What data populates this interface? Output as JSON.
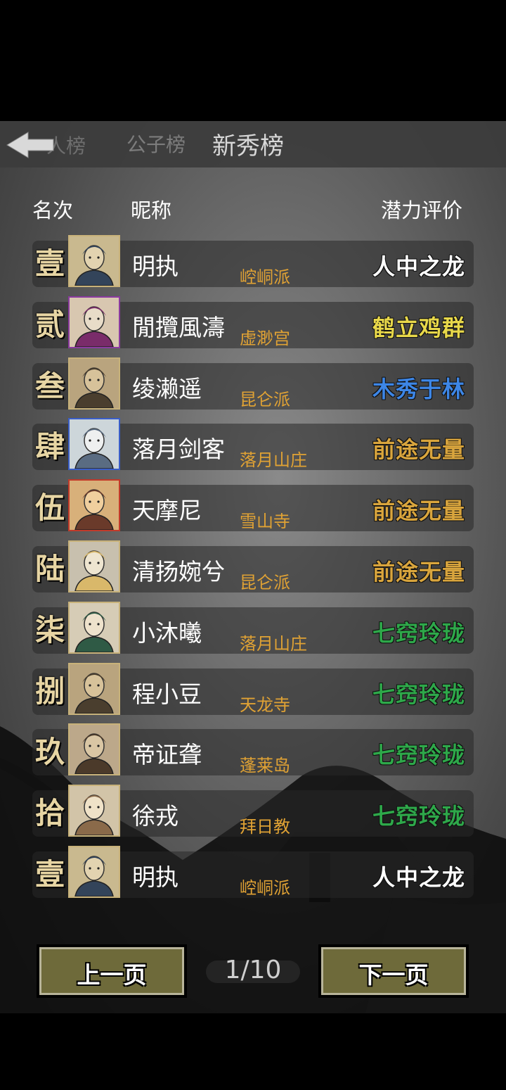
{
  "tabs": [
    {
      "label": "人榜"
    },
    {
      "label": "公子榜"
    },
    {
      "label": "新秀榜"
    }
  ],
  "headers": {
    "rank": "名次",
    "nickname": "昵称",
    "potential": "潜力评价"
  },
  "rating_colors": {
    "gold": "#ffffff",
    "yellow": "#e8d84a",
    "blue": "#4a90e8",
    "orange": "#d8a63c",
    "green": "#2ea84a",
    "white": "#ffffff"
  },
  "rows": [
    {
      "rank": "壹",
      "nick": "明执",
      "sect": "崆峒派",
      "rating": "人中之龙",
      "rating_color": "#ffffff",
      "avatar": "swordsman-portrait",
      "frame": "gold"
    },
    {
      "rank": "贰",
      "nick": "閒攬風濤",
      "sect": "虚渺宫",
      "rating": "鹤立鸡群",
      "rating_color": "#e8d84a",
      "avatar": "dragon-mask-portrait",
      "frame": "purple"
    },
    {
      "rank": "叁",
      "nick": "绫濑遥",
      "sect": "昆仑派",
      "rating": "木秀于林",
      "rating_color": "#3d86e6",
      "avatar": "bearded-elder-portrait",
      "frame": "gold"
    },
    {
      "rank": "肆",
      "nick": "落月剑客",
      "sect": "落月山庄",
      "rating": "前途无量",
      "rating_color": "#d9a53d",
      "avatar": "white-robed-swordsman-portrait",
      "frame": "blue"
    },
    {
      "rank": "伍",
      "nick": "天摩尼",
      "sect": "雪山寺",
      "rating": "前途无量",
      "rating_color": "#d9a53d",
      "avatar": "scholar-portrait",
      "frame": "red"
    },
    {
      "rank": "陆",
      "nick": "清扬婉兮",
      "sect": "昆仑派",
      "rating": "前途无量",
      "rating_color": "#d9a53d",
      "avatar": "blonde-woman-portrait",
      "frame": "gold"
    },
    {
      "rank": "柒",
      "nick": "小沐曦",
      "sect": "落月山庄",
      "rating": "七窍玲珑",
      "rating_color": "#2ea84a",
      "avatar": "lady-portrait",
      "frame": "gold"
    },
    {
      "rank": "捌",
      "nick": "程小豆",
      "sect": "天龙寺",
      "rating": "七窍玲珑",
      "rating_color": "#2ea84a",
      "avatar": "bearded-elder-portrait",
      "frame": "gold"
    },
    {
      "rank": "玖",
      "nick": "帝证聋",
      "sect": "蓬莱岛",
      "rating": "七窍玲珑",
      "rating_color": "#2ea84a",
      "avatar": "eagle-portrait",
      "frame": "gold"
    },
    {
      "rank": "拾",
      "nick": "徐戎",
      "sect": "拜日教",
      "rating": "七窍玲珑",
      "rating_color": "#2ea84a",
      "avatar": "young-girl-portrait",
      "frame": "gold"
    },
    {
      "rank": "壹",
      "nick": "明执",
      "sect": "崆峒派",
      "rating": "人中之龙",
      "rating_color": "#ffffff",
      "avatar": "swordsman-portrait",
      "frame": "gold"
    }
  ],
  "pagination": {
    "prev_label": "上一页",
    "next_label": "下一页",
    "indicator": "1/10"
  }
}
